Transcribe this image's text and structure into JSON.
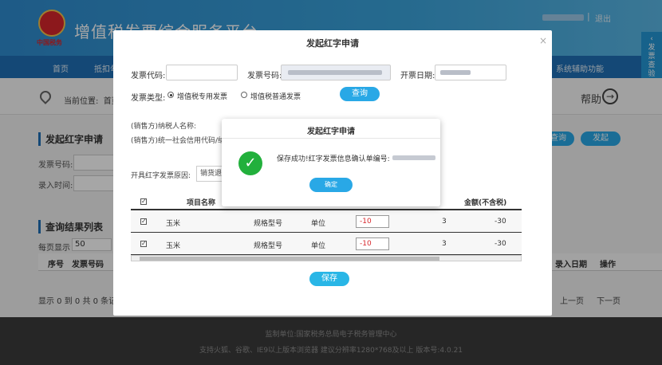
{
  "header": {
    "title": "增值税发票综合服务平台",
    "logo_text": "中国税务",
    "exit_label": "退出"
  },
  "nav": {
    "items": [
      "首页",
      "抵扣勾选",
      "系统辅助功能"
    ]
  },
  "side_tab": {
    "label": "发票查验平台"
  },
  "breadcrumb": {
    "prefix": "当前位置:",
    "current": "首页",
    "help": "帮助",
    "help_icon": "arrow-right-icon"
  },
  "background": {
    "section_title": "发起红字申请",
    "invoice_no_label": "发票号码:",
    "entry_time_label": "录入时间:",
    "query_button": "查询",
    "submit_button": "发起",
    "results_title": "查询结果列表",
    "per_page_label": "每页显示",
    "per_page_value": "50",
    "columns": [
      "序号",
      "发票号码",
      "录入日期",
      "操作"
    ],
    "pagination_summary": "显示 0 到 0 共 0 条记录",
    "prev_page": "上一页",
    "next_page": "下一页"
  },
  "modal": {
    "title": "发起红字申请",
    "invoice_code_label": "发票代码:",
    "invoice_code_value": "",
    "invoice_number_label": "发票号码:",
    "issue_date_label": "开票日期:",
    "invoice_type_label": "发票类型:",
    "type_options": [
      {
        "label": "增值税专用发票",
        "selected": true
      },
      {
        "label": "增值税普通发票",
        "selected": false
      }
    ],
    "query_button": "查询",
    "seller_name_label": "(销售方)纳税人名称:",
    "seller_code_label": "(销售方)统一社会信用代码/纳",
    "reason_label": "开具红字发票原因:",
    "reason_value": "销货退回",
    "table": {
      "headers": [
        "项目名称",
        "金额(不含税)"
      ],
      "rows": [
        {
          "name": "玉米",
          "spec": "规格型号",
          "unit": "单位",
          "qty": "-10",
          "price": "3",
          "amount": "-30"
        },
        {
          "name": "玉米",
          "spec": "规格型号",
          "unit": "单位",
          "qty": "-10",
          "price": "3",
          "amount": "-30"
        }
      ]
    },
    "save_button": "保存"
  },
  "dialog": {
    "title": "发起红字申请",
    "message": "保存成功!红字发票信息确认单编号:",
    "ok_button": "确定",
    "icon": "checkmark-icon"
  },
  "footer": {
    "line1": "监制单位:国家税务总局电子税务管理中心",
    "line2": "支持火狐、谷歌、IE9以上版本浏览器   建议分辨率1280*768及以上   版本号:4.0.21"
  },
  "colors": {
    "primary": "#1f6fb5",
    "accent": "#29a8e6",
    "success": "#22b03c",
    "negative": "#d7262b"
  }
}
